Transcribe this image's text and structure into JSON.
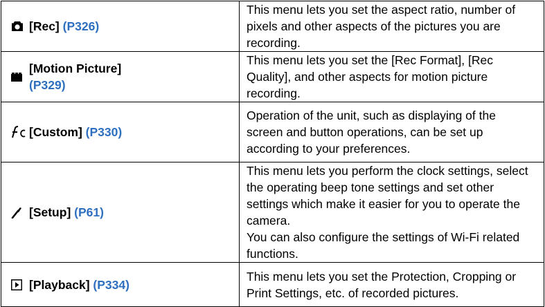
{
  "menus": [
    {
      "icon": "camera-icon",
      "name": "[Rec]",
      "page_ref": "(P326)",
      "description": "This menu lets you set the aspect ratio, number of pixels and other aspects of the pictures you are recording."
    },
    {
      "icon": "motion-picture-icon",
      "name": "[Motion Picture]",
      "page_ref": "(P329)",
      "description": "This menu lets you set the [Rec Format], [Rec Quality], and other aspects for motion picture recording."
    },
    {
      "icon": "custom-icon",
      "name": "[Custom]",
      "page_ref": "(P330)",
      "description": "Operation of the unit, such as displaying of the screen and button operations, can be set up according to your preferences."
    },
    {
      "icon": "wrench-icon",
      "name": "[Setup]",
      "page_ref": "(P61)",
      "description": "This menu lets you perform the clock settings, select the operating beep tone settings and set other settings which make it easier for you to operate the camera.",
      "description_2": "You can also configure the settings of Wi-Fi related functions."
    },
    {
      "icon": "playback-icon",
      "name": "[Playback]",
      "page_ref": "(P334)",
      "description": "This menu lets you set the Protection, Cropping or Print Settings, etc. of recorded pictures."
    }
  ]
}
